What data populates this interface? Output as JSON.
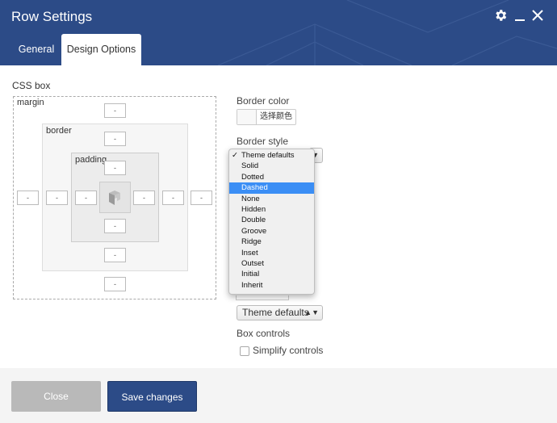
{
  "header": {
    "title": "Row Settings",
    "tabs": [
      {
        "label": "General",
        "active": false
      },
      {
        "label": "Design Options",
        "active": true
      }
    ],
    "icons": [
      "gear-icon",
      "minimize-icon",
      "close-icon"
    ]
  },
  "css_box": {
    "label": "CSS box",
    "margin_label": "margin",
    "border_label": "border",
    "padding_label": "padding",
    "margin": {
      "top": "-",
      "right": "-",
      "bottom": "-",
      "left": "-"
    },
    "border": {
      "top": "-",
      "right": "-",
      "bottom": "-",
      "left": "-"
    },
    "padding": {
      "top": "-",
      "right": "-",
      "bottom": "-",
      "left": "-"
    }
  },
  "border_color": {
    "label": "Border color",
    "button_label": "选择颜色"
  },
  "border_style": {
    "label": "Border style",
    "arrows": "▲▼",
    "options": [
      "Theme defaults",
      "Solid",
      "Dotted",
      "Dashed",
      "None",
      "Hidden",
      "Double",
      "Groove",
      "Ridge",
      "Inset",
      "Outset",
      "Initial",
      "Inherit"
    ],
    "checked": "Theme defaults",
    "highlighted": "Dashed",
    "check_mark": "✓"
  },
  "background_style": {
    "selected": "Theme defaults",
    "arrows": "▲▼"
  },
  "box_controls": {
    "label": "Box controls",
    "simplify_label": "Simplify controls",
    "checked": false
  },
  "footer": {
    "close_label": "Close",
    "save_label": "Save changes"
  },
  "colors": {
    "header": "#2c4b87",
    "highlight": "#3b8ef5",
    "close_button": "#b9b9b9"
  }
}
